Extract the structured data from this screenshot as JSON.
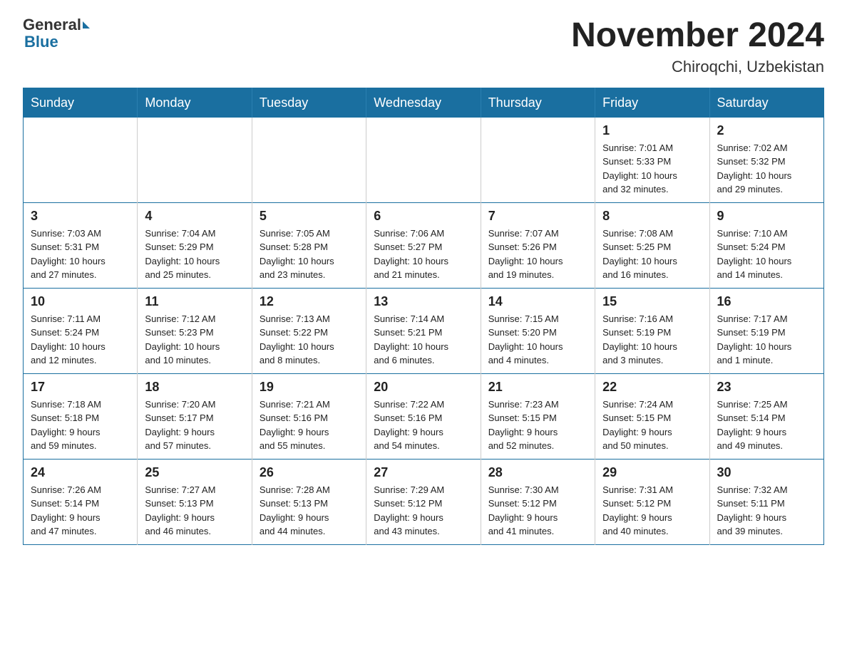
{
  "logo": {
    "general": "General",
    "blue": "Blue"
  },
  "title": "November 2024",
  "location": "Chiroqchi, Uzbekistan",
  "weekdays": [
    "Sunday",
    "Monday",
    "Tuesday",
    "Wednesday",
    "Thursday",
    "Friday",
    "Saturday"
  ],
  "weeks": [
    [
      {
        "day": "",
        "info": ""
      },
      {
        "day": "",
        "info": ""
      },
      {
        "day": "",
        "info": ""
      },
      {
        "day": "",
        "info": ""
      },
      {
        "day": "",
        "info": ""
      },
      {
        "day": "1",
        "info": "Sunrise: 7:01 AM\nSunset: 5:33 PM\nDaylight: 10 hours\nand 32 minutes."
      },
      {
        "day": "2",
        "info": "Sunrise: 7:02 AM\nSunset: 5:32 PM\nDaylight: 10 hours\nand 29 minutes."
      }
    ],
    [
      {
        "day": "3",
        "info": "Sunrise: 7:03 AM\nSunset: 5:31 PM\nDaylight: 10 hours\nand 27 minutes."
      },
      {
        "day": "4",
        "info": "Sunrise: 7:04 AM\nSunset: 5:29 PM\nDaylight: 10 hours\nand 25 minutes."
      },
      {
        "day": "5",
        "info": "Sunrise: 7:05 AM\nSunset: 5:28 PM\nDaylight: 10 hours\nand 23 minutes."
      },
      {
        "day": "6",
        "info": "Sunrise: 7:06 AM\nSunset: 5:27 PM\nDaylight: 10 hours\nand 21 minutes."
      },
      {
        "day": "7",
        "info": "Sunrise: 7:07 AM\nSunset: 5:26 PM\nDaylight: 10 hours\nand 19 minutes."
      },
      {
        "day": "8",
        "info": "Sunrise: 7:08 AM\nSunset: 5:25 PM\nDaylight: 10 hours\nand 16 minutes."
      },
      {
        "day": "9",
        "info": "Sunrise: 7:10 AM\nSunset: 5:24 PM\nDaylight: 10 hours\nand 14 minutes."
      }
    ],
    [
      {
        "day": "10",
        "info": "Sunrise: 7:11 AM\nSunset: 5:24 PM\nDaylight: 10 hours\nand 12 minutes."
      },
      {
        "day": "11",
        "info": "Sunrise: 7:12 AM\nSunset: 5:23 PM\nDaylight: 10 hours\nand 10 minutes."
      },
      {
        "day": "12",
        "info": "Sunrise: 7:13 AM\nSunset: 5:22 PM\nDaylight: 10 hours\nand 8 minutes."
      },
      {
        "day": "13",
        "info": "Sunrise: 7:14 AM\nSunset: 5:21 PM\nDaylight: 10 hours\nand 6 minutes."
      },
      {
        "day": "14",
        "info": "Sunrise: 7:15 AM\nSunset: 5:20 PM\nDaylight: 10 hours\nand 4 minutes."
      },
      {
        "day": "15",
        "info": "Sunrise: 7:16 AM\nSunset: 5:19 PM\nDaylight: 10 hours\nand 3 minutes."
      },
      {
        "day": "16",
        "info": "Sunrise: 7:17 AM\nSunset: 5:19 PM\nDaylight: 10 hours\nand 1 minute."
      }
    ],
    [
      {
        "day": "17",
        "info": "Sunrise: 7:18 AM\nSunset: 5:18 PM\nDaylight: 9 hours\nand 59 minutes."
      },
      {
        "day": "18",
        "info": "Sunrise: 7:20 AM\nSunset: 5:17 PM\nDaylight: 9 hours\nand 57 minutes."
      },
      {
        "day": "19",
        "info": "Sunrise: 7:21 AM\nSunset: 5:16 PM\nDaylight: 9 hours\nand 55 minutes."
      },
      {
        "day": "20",
        "info": "Sunrise: 7:22 AM\nSunset: 5:16 PM\nDaylight: 9 hours\nand 54 minutes."
      },
      {
        "day": "21",
        "info": "Sunrise: 7:23 AM\nSunset: 5:15 PM\nDaylight: 9 hours\nand 52 minutes."
      },
      {
        "day": "22",
        "info": "Sunrise: 7:24 AM\nSunset: 5:15 PM\nDaylight: 9 hours\nand 50 minutes."
      },
      {
        "day": "23",
        "info": "Sunrise: 7:25 AM\nSunset: 5:14 PM\nDaylight: 9 hours\nand 49 minutes."
      }
    ],
    [
      {
        "day": "24",
        "info": "Sunrise: 7:26 AM\nSunset: 5:14 PM\nDaylight: 9 hours\nand 47 minutes."
      },
      {
        "day": "25",
        "info": "Sunrise: 7:27 AM\nSunset: 5:13 PM\nDaylight: 9 hours\nand 46 minutes."
      },
      {
        "day": "26",
        "info": "Sunrise: 7:28 AM\nSunset: 5:13 PM\nDaylight: 9 hours\nand 44 minutes."
      },
      {
        "day": "27",
        "info": "Sunrise: 7:29 AM\nSunset: 5:12 PM\nDaylight: 9 hours\nand 43 minutes."
      },
      {
        "day": "28",
        "info": "Sunrise: 7:30 AM\nSunset: 5:12 PM\nDaylight: 9 hours\nand 41 minutes."
      },
      {
        "day": "29",
        "info": "Sunrise: 7:31 AM\nSunset: 5:12 PM\nDaylight: 9 hours\nand 40 minutes."
      },
      {
        "day": "30",
        "info": "Sunrise: 7:32 AM\nSunset: 5:11 PM\nDaylight: 9 hours\nand 39 minutes."
      }
    ]
  ]
}
